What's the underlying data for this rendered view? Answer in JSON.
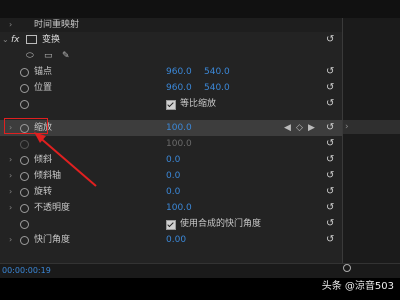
{
  "header": {
    "title": "时间重映射"
  },
  "transform": {
    "fx": "fx",
    "name": "变换",
    "tools": [
      "ellipse",
      "rectangle",
      "pen"
    ]
  },
  "properties": [
    {
      "label": "锚点",
      "v1": "960.0",
      "v2": "540.0"
    },
    {
      "label": "位置",
      "v1": "960.0",
      "v2": "540.0"
    },
    {
      "label": "",
      "checkbox": "等比缩放"
    },
    {
      "label": "缩放",
      "v1": "100.0"
    },
    {
      "label": "",
      "v1": "100.0"
    },
    {
      "label": "倾斜",
      "v1": "0.0"
    },
    {
      "label": "倾斜轴",
      "v1": "0.0"
    },
    {
      "label": "旋转",
      "v1": "0.0"
    },
    {
      "label": "不透明度",
      "v1": "100.0"
    },
    {
      "label": "",
      "checkbox": "使用合成的快门角度"
    },
    {
      "label": "快门角度",
      "v1": "0.00"
    }
  ],
  "keyframe_nav": {
    "value": "0"
  },
  "status": {
    "timecode": "00:00:00:19"
  },
  "watermark": {
    "text": "头条 @涼音503"
  },
  "colors": {
    "accent": "#3b88d8",
    "highlight": "#e02020"
  }
}
